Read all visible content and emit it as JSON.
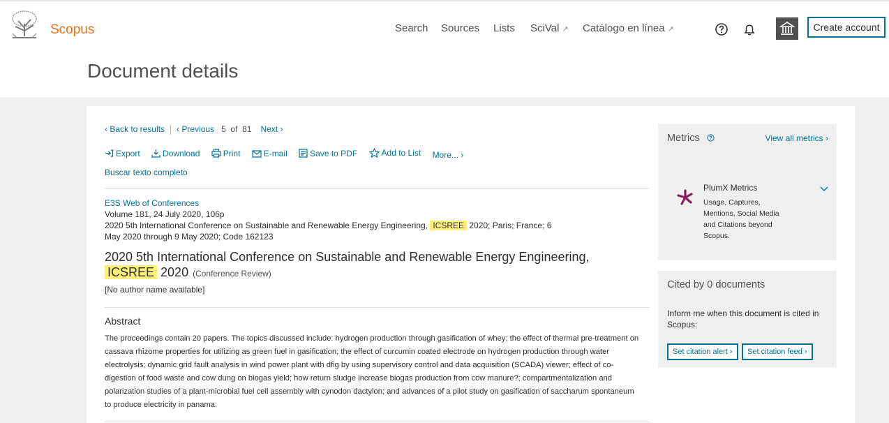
{
  "header": {
    "brand": "Scopus",
    "nav": [
      {
        "label": "Search",
        "external": false
      },
      {
        "label": "Sources",
        "external": false
      },
      {
        "label": "Lists",
        "external": false
      },
      {
        "label": "SciVal",
        "external": true
      },
      {
        "label": "Catálogo en línea",
        "external": true
      }
    ],
    "external_glyph": "↗",
    "create_account": "Create account",
    "icons": [
      "help-icon",
      "bell-icon",
      "institution-icon"
    ]
  },
  "page_title": "Document details",
  "pager": {
    "back": "‹ Back to results",
    "previous": "‹ Previous",
    "current": "5",
    "of": "of",
    "total": "81",
    "next": "Next ›"
  },
  "actions": {
    "export": "Export",
    "download": "Download",
    "print": "Print",
    "email": "E-mail",
    "save_pdf": "Save to PDF",
    "add_list": "Add to List",
    "more": "More... ›",
    "full_text": "Buscar texto completo"
  },
  "source": {
    "journal": "E3S Web of Conferences",
    "volume": "Volume 181, 24 July 2020, 106p",
    "conf_pre": "2020 5th International Conference on Sustainable and Renewable Energy Engineering, ",
    "conf_highlight": "ICSREE",
    "conf_post": " 2020; Paris; France; 6 May 2020 through 9 May 2020; Code 162123"
  },
  "document": {
    "title_pre": "2020 5th International Conference on Sustainable and Renewable Energy Engineering, ",
    "title_highlight": "ICSREE",
    "title_post": " 2020",
    "type": "(Conference Review)",
    "authors": "[No author name available]"
  },
  "abstract": {
    "heading": "Abstract",
    "text": "The proceedings contain 20 papers. The topics discussed include: hydrogen production through gasification of whey; the effect of thermal pre-treatment on cassava rhizome properties for utilizing as green fuel in gasification; the effect of curcumin coated electrode on hydrogen production through water electrolysis; dynamic grid fault analysis in wind power plant with dfig by using supervisory control and data acquisition (SCADA) viewer; effect of co-digestion of food waste and cow dung on biogas yield; how return sludge increase biogas production from cow manure?; compartmentalization and polarization studies of a plant-microbial fuel cell assembly with cynodon dactylon; and advances of a pilot study on gasification of saccharum spontaneum to produce electricity in panama."
  },
  "metrics": {
    "title": "Metrics",
    "view_all": "View all metrics ›",
    "plumx_title": "PlumX Metrics",
    "plumx_desc": "Usage, Captures, Mentions, Social Media and Citations beyond Scopus.",
    "plumx_color": "#8b1e5a"
  },
  "cited": {
    "title": "Cited by 0 documents",
    "message": "Inform me when this document is cited in Scopus:",
    "alert_btn": "Set citation alert ›",
    "feed_btn": "Set citation feed ›"
  },
  "colors": {
    "accent": "#007398",
    "brand": "#e9711c",
    "highlight": "#fff07a"
  }
}
